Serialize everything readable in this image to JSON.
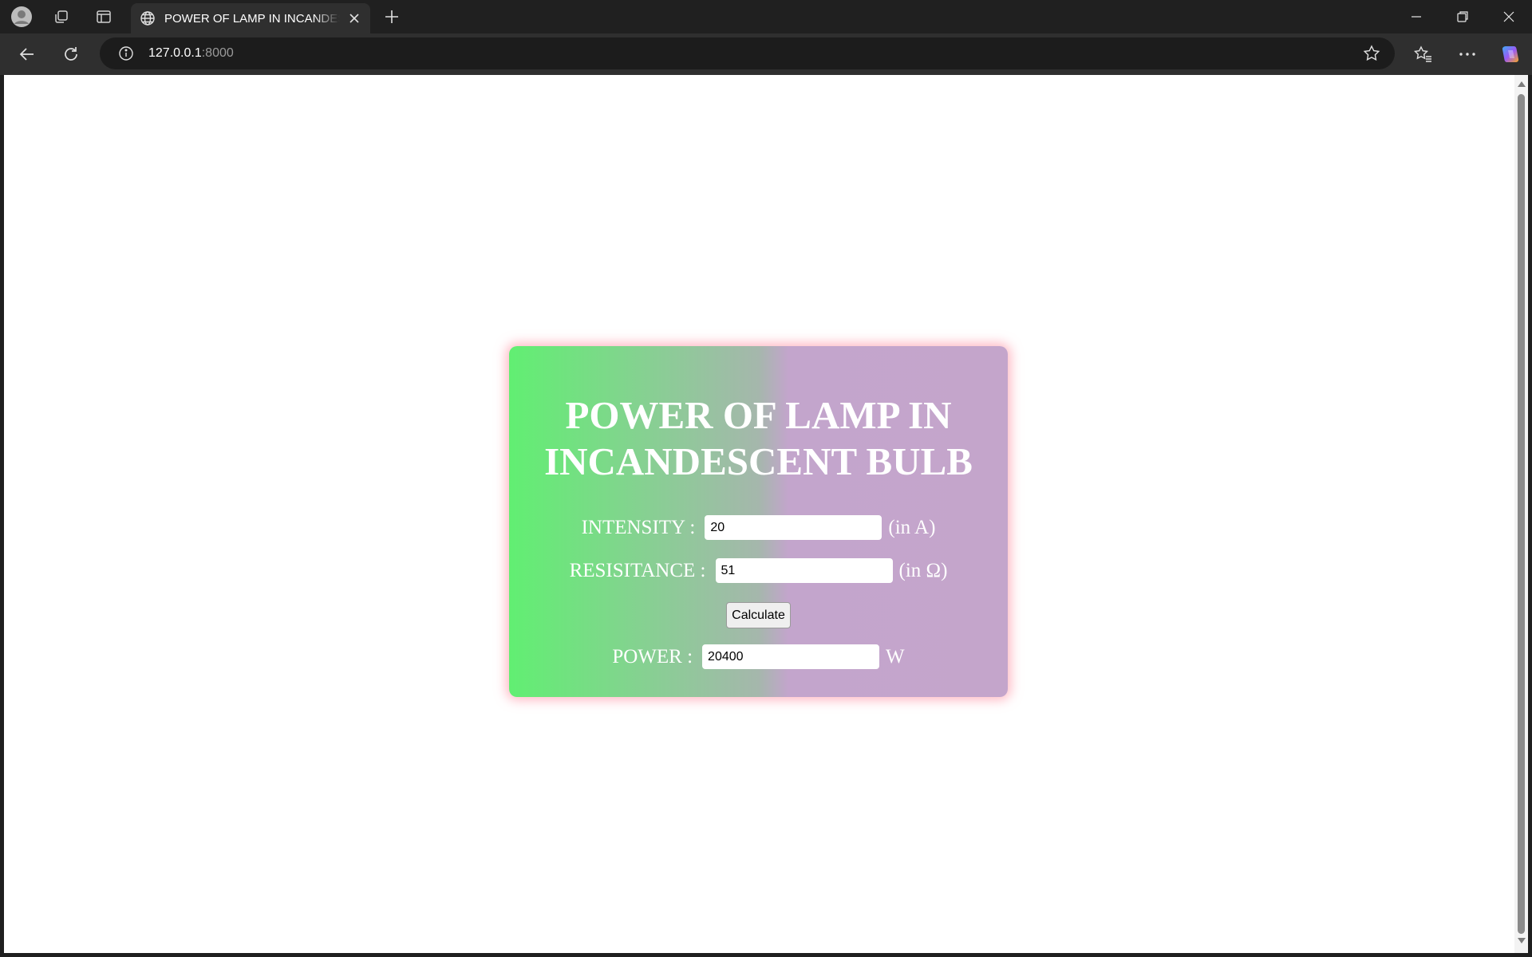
{
  "browser": {
    "tab_title": "POWER OF LAMP IN INCANDESCENT BULB",
    "url_host": "127.0.0.1",
    "url_port": ":8000"
  },
  "page": {
    "title": "POWER OF LAMP IN INCANDESCENT BULB",
    "intensity": {
      "label": "INTENSITY :",
      "value": "20",
      "unit": "(in A)"
    },
    "resistance": {
      "label": "RESISITANCE :",
      "value": "51",
      "unit": "(in Ω)"
    },
    "calculate_label": "Calculate",
    "power": {
      "label": "POWER :",
      "value": "20400",
      "unit": "W"
    }
  },
  "colors": {
    "gradient_start": "#61ef72",
    "gradient_end": "#c4a5cb",
    "card_glow": "#ff8296"
  }
}
